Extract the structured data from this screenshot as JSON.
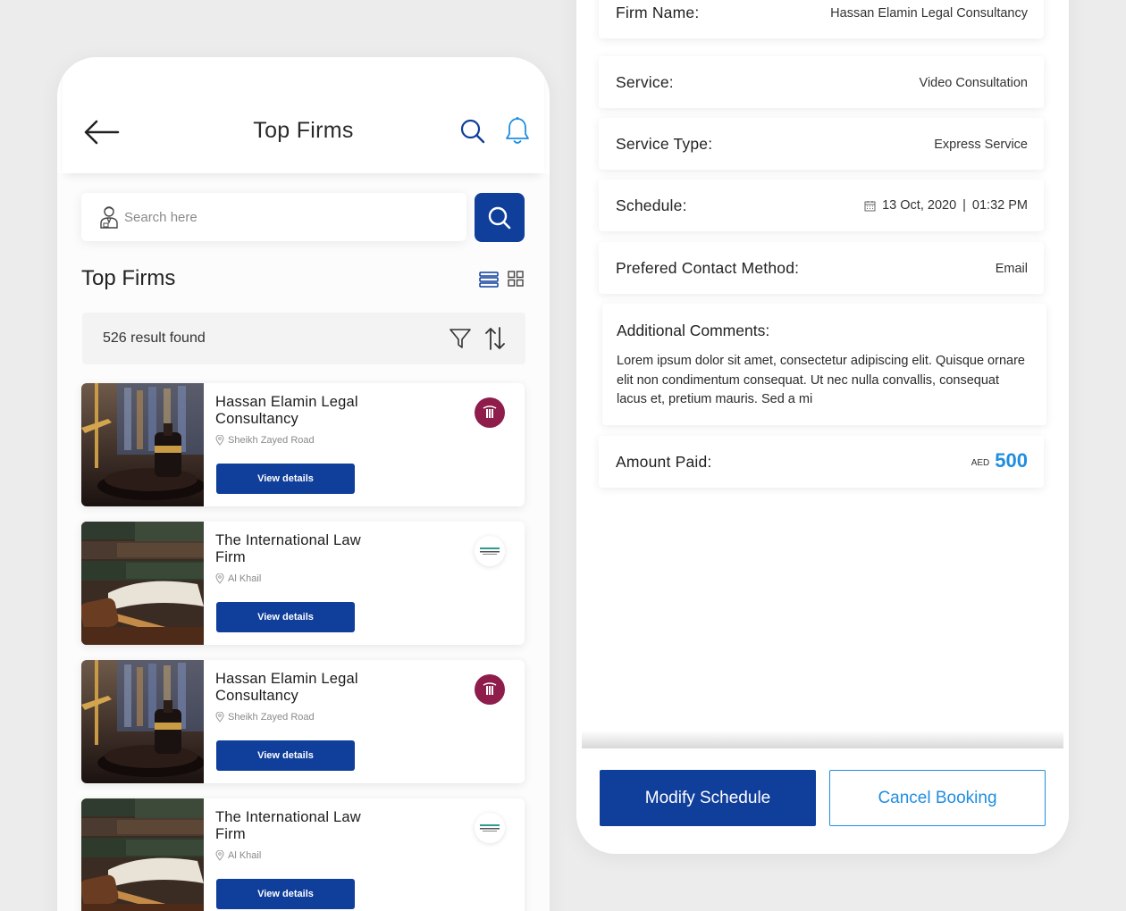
{
  "left": {
    "header": {
      "title": "Top Firms",
      "back_icon": "arrow-left-icon",
      "search_icon": "search-icon",
      "bell_icon": "bell-icon"
    },
    "search": {
      "placeholder": "Search here",
      "value": ""
    },
    "section_title": "Top Firms",
    "results_text": "526 result found",
    "firms": [
      {
        "name": "Hassan Elamin Legal Consultancy",
        "location": "Sheikh Zayed Road",
        "button": "View details",
        "logo": "maroon"
      },
      {
        "name": "The International Law Firm",
        "location": "Al Khail",
        "button": "View details",
        "logo": "white"
      },
      {
        "name": "Hassan Elamin Legal Consultancy",
        "location": "Sheikh Zayed Road",
        "button": "View details",
        "logo": "maroon"
      },
      {
        "name": "The International Law Firm",
        "location": "Al Khail",
        "button": "View details",
        "logo": "white"
      }
    ]
  },
  "right": {
    "firm_name": {
      "label": "Firm Name:",
      "value": "Hassan Elamin Legal Consultancy"
    },
    "service": {
      "label": "Service:",
      "value": "Video Consultation"
    },
    "service_type": {
      "label": "Service Type:",
      "value": "Express Service"
    },
    "schedule": {
      "label": "Schedule:",
      "date": "13 Oct, 2020",
      "separator": "|",
      "time": "01:32 PM"
    },
    "contact": {
      "label": "Prefered Contact Method:",
      "value": "Email"
    },
    "comments": {
      "title": "Additional Comments:",
      "body": "Lorem ipsum dolor sit amet, consectetur adipiscing elit. Quisque ornare elit non condimentum consequat. Ut nec nulla convallis, consequat lacus et, pretium mauris. Sed a mi"
    },
    "amount": {
      "label": "Amount Paid:",
      "currency": "AED",
      "value": "500"
    },
    "buttons": {
      "modify": "Modify Schedule",
      "cancel": "Cancel Booking"
    }
  },
  "colors": {
    "primary": "#0f3e9b",
    "accent": "#1f8ee0",
    "logo_maroon": "#8e1d4c"
  }
}
